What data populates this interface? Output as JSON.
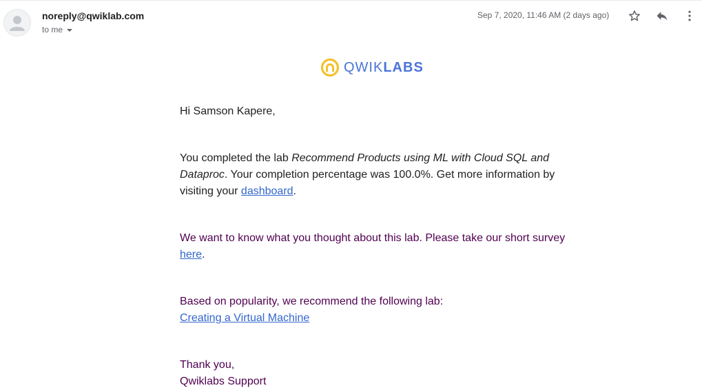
{
  "header": {
    "sender": "noreply@qwiklab.com",
    "recipient": "to me",
    "date": "Sep 7, 2020, 11:46 AM (2 days ago)",
    "icons": [
      "avatar-icon",
      "star-icon",
      "reply-icon",
      "more-vert-icon"
    ]
  },
  "logo": {
    "prefix": "QWIK",
    "suffix": "LABS",
    "colors": {
      "ring": "#f2c12e",
      "text": "#4a74d8"
    }
  },
  "body": {
    "greeting": "Hi Samson Kapere,",
    "completion": {
      "before": "You completed the lab ",
      "lab_name": "Recommend Products using ML with Cloud SQL and Dataproc",
      "after": ". Your completion percentage was 100.0%. Get more information by visiting your ",
      "link": "dashboard",
      "end": "."
    },
    "survey": {
      "before": "We want to know what you thought about this lab. Please take our short survey ",
      "link": "here",
      "end": "."
    },
    "recommend": {
      "text": "Based on popularity, we recommend the following lab:",
      "link": "Creating a Virtual Machine"
    },
    "signoff": {
      "thanks": "Thank you,",
      "team": "Qwiklabs Support"
    }
  },
  "colors": {
    "link": "#3366cc",
    "quoted_text": "#500050",
    "secondary": "#5f6368"
  }
}
